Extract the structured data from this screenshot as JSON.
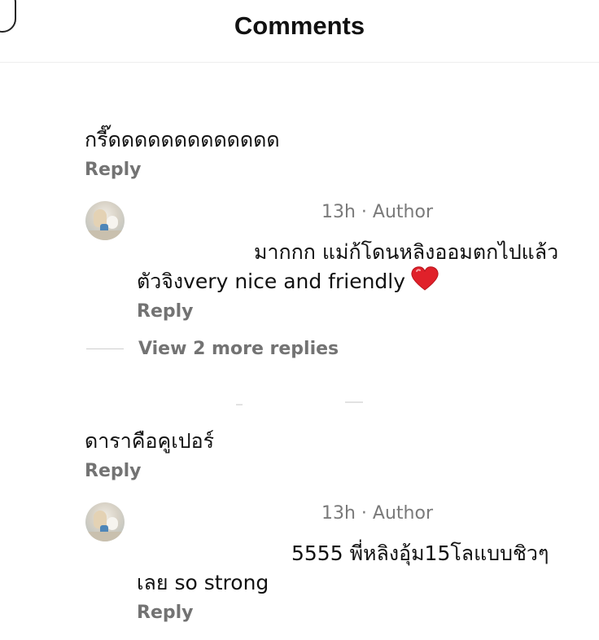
{
  "header": {
    "title": "Comments"
  },
  "comments": [
    {
      "text": "กรี๊ดดดดดดดดดดดดด",
      "reply_label": "Reply",
      "author_reply": {
        "meta": "13h · Author",
        "line1": "มากกก แม่ก้โดนหลิงออมตกไปแล้ว",
        "line2": "ตัวจิงvery nice and friendly",
        "heart_icon": "red-heart-icon",
        "heart_color": "#e0212a",
        "reply_label": "Reply"
      },
      "view_more": "View 2 more replies"
    },
    {
      "text": "ดาราคือคูเปอร์",
      "reply_label": "Reply",
      "author_reply": {
        "meta": "13h · Author",
        "line1": "5555 พี่หลิงอุ้ม15โลแบบชิวๆ",
        "line2": "เลย so strong",
        "reply_label": "Reply"
      }
    }
  ]
}
